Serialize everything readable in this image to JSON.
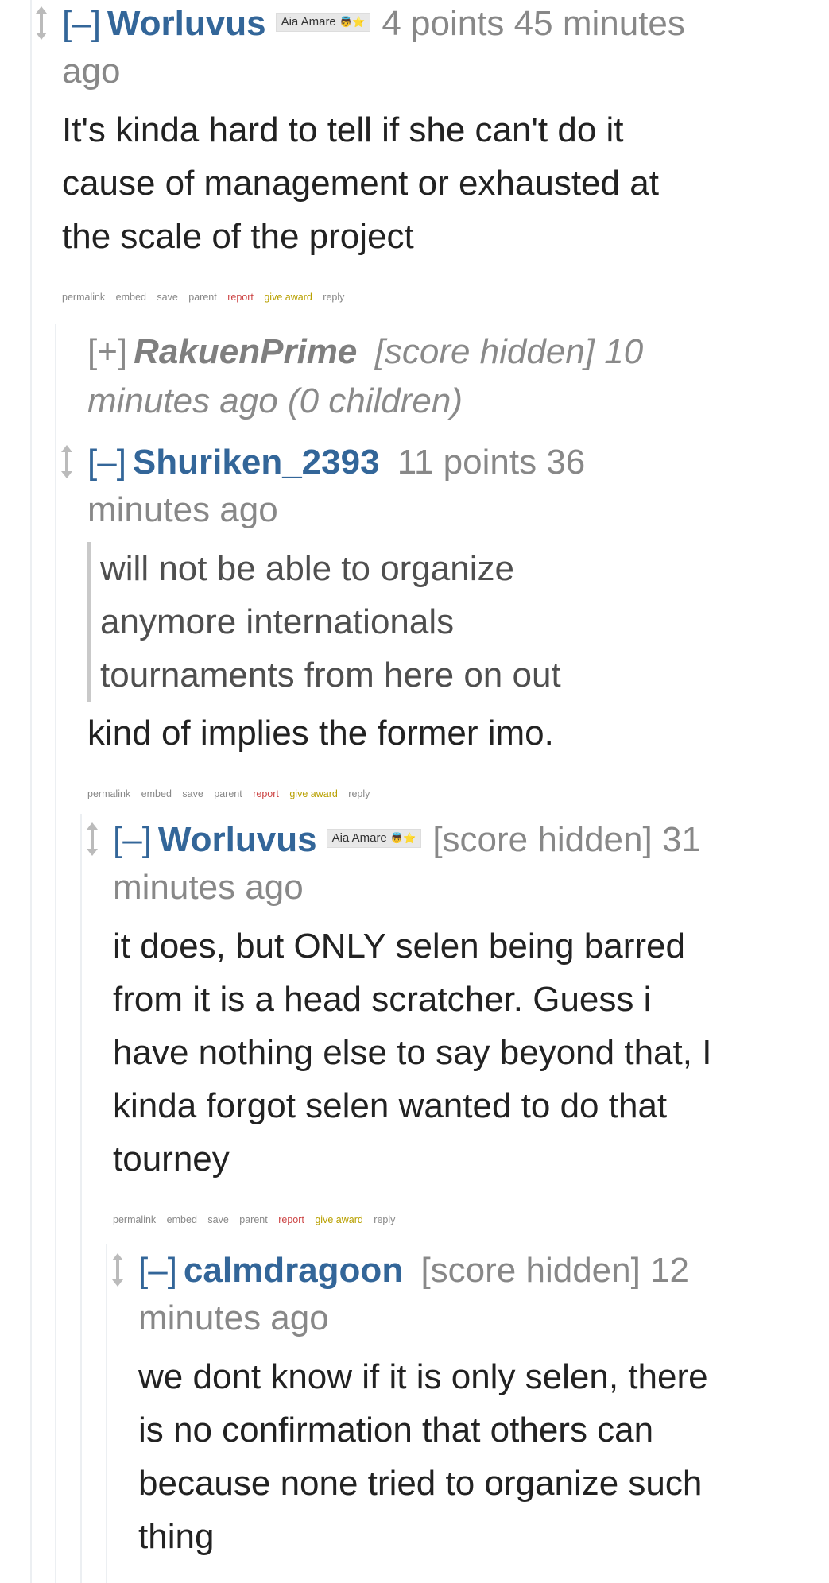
{
  "comments": [
    {
      "toggle": "[–]",
      "author": "Worluvus",
      "flair_text": "Aia Amare",
      "flair_emoji": "👼⭐",
      "score": "4 points",
      "time": "45 minutes ago",
      "body": "It's kinda hard to tell if she can't do it cause of management or exhausted at the scale of the project"
    },
    {
      "toggle": "[+]",
      "author": "RakuenPrime",
      "score": "[score hidden]",
      "time": "10 minutes ago",
      "children": "(0 children)"
    },
    {
      "toggle": "[–]",
      "author": "Shuriken_2393",
      "score": "11 points",
      "time": "36 minutes ago",
      "quote": "will not be able to organize anymore internationals tournaments from here on out",
      "body": "kind of implies the former imo."
    },
    {
      "toggle": "[–]",
      "author": "Worluvus",
      "flair_text": "Aia Amare",
      "flair_emoji": "👼⭐",
      "score": "[score hidden]",
      "time": "31 minutes ago",
      "body": "it does, but ONLY selen being barred from it is a head scratcher. Guess i have nothing else to say beyond that, I kinda forgot selen wanted to do that tourney"
    },
    {
      "toggle": "[–]",
      "author": "calmdragoon",
      "score": "[score hidden]",
      "time": "12 minutes ago",
      "body": "we dont know if it is only selen, there is no confirmation that others can because none tried to organize such thing"
    }
  ],
  "buttons": {
    "permalink": "permalink",
    "embed": "embed",
    "save": "save",
    "parent": "parent",
    "report": "report",
    "give_award": "give award",
    "reply": "reply"
  },
  "colors": {
    "author": "#336699",
    "meta": "#888888",
    "report": "#cc4444",
    "award": "#b8a000"
  }
}
